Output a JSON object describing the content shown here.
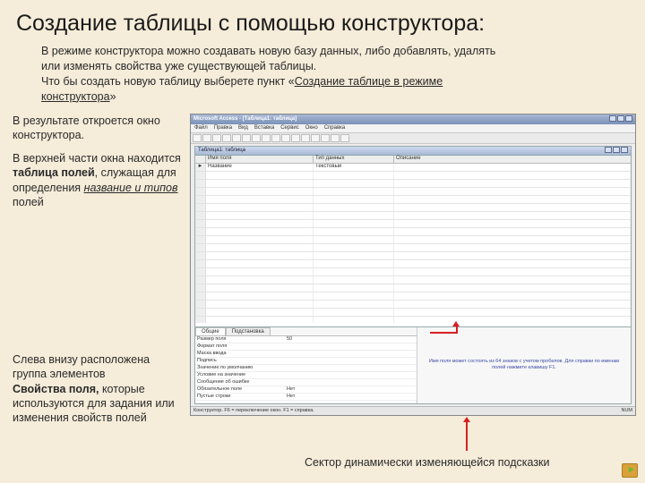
{
  "title": "Создание таблицы с помощью конструктора:",
  "intro": {
    "l1": "В режиме конструктора можно создавать новую базу данных, либо добавлять, удалять",
    "l2": "или изменять свойства уже существующей таблицы.",
    "l3a": "Что бы создать новую таблицу выберете пункт «",
    "l3link": "Создание таблице в режиме",
    "l4link": "конструктора",
    "l4b": "»"
  },
  "left": {
    "p1": "В результате откроется окно конструктора.",
    "p2a": "В верхней части окна находится ",
    "p2b": "таблица полей",
    "p2c": ", служащая для определения ",
    "p2link": "название и типов",
    "p2d": " полей",
    "p3a": "Слева внизу расположена группа элементов ",
    "p3b": "Свойства поля,",
    "p3c": " которые используются для задания или изменения свойств полей"
  },
  "screenshot": {
    "app_title": "Microsoft Access - [Таблица1: таблица]",
    "menus": [
      "Файл",
      "Правка",
      "Вид",
      "Вставка",
      "Сервис",
      "Окно",
      "Справка"
    ],
    "inner_title": "Таблица1: таблица",
    "grid_head": {
      "name": "Имя поля",
      "type": "Тип данных",
      "desc": "Описание"
    },
    "rows": [
      {
        "marker": "►",
        "name": "Название",
        "type": "Текстовый"
      },
      {
        "marker": "",
        "name": "",
        "type": ""
      }
    ],
    "props_section_label": "Свойства поля",
    "tabs": {
      "general": "Общие",
      "lookup": "Подстановка"
    },
    "props": [
      {
        "label": "Размер поля",
        "value": "50"
      },
      {
        "label": "Формат поля",
        "value": ""
      },
      {
        "label": "Маска ввода",
        "value": ""
      },
      {
        "label": "Подпись",
        "value": ""
      },
      {
        "label": "Значение по умолчанию",
        "value": ""
      },
      {
        "label": "Условие на значение",
        "value": ""
      },
      {
        "label": "Сообщение об ошибке",
        "value": ""
      },
      {
        "label": "Обязательное поле",
        "value": "Нет"
      },
      {
        "label": "Пустые строки",
        "value": "Нет"
      }
    ],
    "hint": "Имя поля может состоять из 64 знаков с учетом пробелов. Для справки по именам полей нажмите клавишу F1.",
    "status_left": "Конструктор. F6 = переключение окон. F1 = справка.",
    "status_right": "NUM"
  },
  "footnote": "Сектор динамически изменяющейся подсказки"
}
